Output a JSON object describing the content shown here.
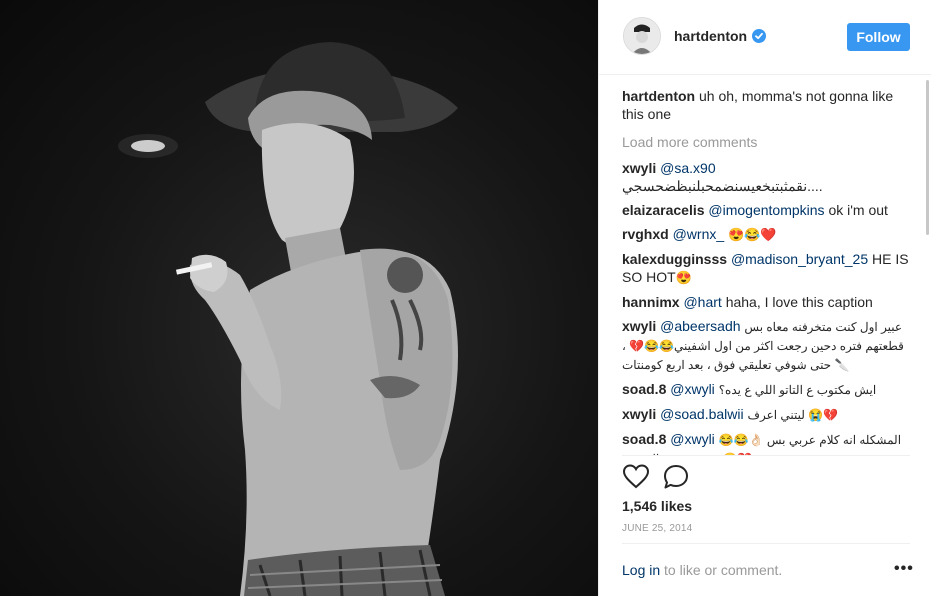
{
  "post": {
    "username": "hartdenton",
    "follow_label": "Follow",
    "caption": {
      "user": "hartdenton",
      "text": "uh oh, momma's not gonna like this one"
    },
    "load_more": "Load more comments",
    "comments": [
      {
        "user": "xwyli",
        "mention": "@sa.x90",
        "text": " نقمثبتبخعيسنضمحبلنبظضحسجي....",
        "emoji": ""
      },
      {
        "user": "elaizaracelis",
        "mention": "@imogentompkins",
        "text": " ok i'm out",
        "emoji": ""
      },
      {
        "user": "rvghxd",
        "mention": "@wrnx_",
        "text": " ",
        "emoji": "😍😂❤️"
      },
      {
        "user": "kalexdugginsss",
        "mention": "@madison_bryant_25",
        "text": " HE IS SO HOT",
        "emoji": "😍"
      },
      {
        "user": "hannimx",
        "mention": "@hart",
        "text": " haha, I love this caption",
        "emoji": ""
      },
      {
        "user": "xwyli",
        "mention": "@abeersadh",
        "text": " عبير اول كنت متخرفنه معاه بس قطعتهم فتره دحين رجعت اكثر من اول اشفيني😂😂💔 ، حتى شوفي تعليقي فوق ، بعد اربع كومنتات 🔪",
        "emoji": ""
      },
      {
        "user": "soad.8",
        "mention": "@xwyli",
        "text": " ايش مكتوب ع التاتو اللي ع يده؟",
        "emoji": ""
      },
      {
        "user": "xwyli",
        "mention": "@soad.balwii",
        "text": " ليتني اعرف 😭💔",
        "emoji": ""
      },
      {
        "user": "soad.8",
        "mention": "@xwyli",
        "text": " 😂😂👌🏻 المشكله انه كلام عربي بس مو موضحه بالتصوير 😕💔",
        "emoji": ""
      }
    ],
    "likes": "1,546 likes",
    "date": "JUNE 25, 2014",
    "login_link": "Log in",
    "login_text": " to like or comment.",
    "more": "•••"
  },
  "icons": {
    "verified": "verified-badge-icon",
    "like": "heart-icon",
    "comment": "comment-icon",
    "more": "more-options-icon"
  },
  "colors": {
    "follow_bg": "#3897f0",
    "verified": "#3897f0",
    "mention": "#003569",
    "muted": "#999999"
  }
}
